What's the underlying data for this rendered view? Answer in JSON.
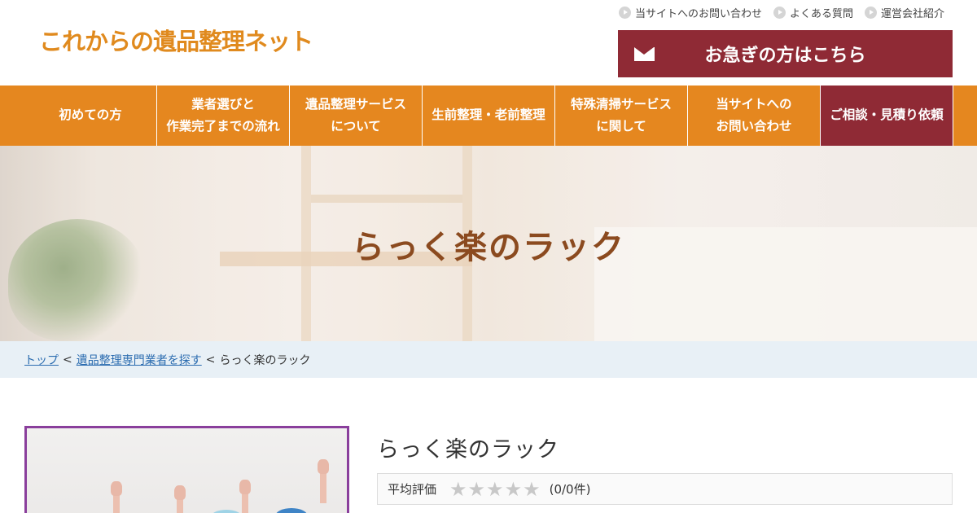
{
  "header": {
    "logo": "これからの遺品整理ネット",
    "top_links": [
      "当サイトへのお問い合わせ",
      "よくある質問",
      "運営会社紹介"
    ],
    "urgent_label": "お急ぎの方はこちら"
  },
  "nav": {
    "items": [
      {
        "label": "初めての方"
      },
      {
        "label": "業者選びと\n作業完了までの流れ"
      },
      {
        "label": "遺品整理サービス\nについて"
      },
      {
        "label": "生前整理・老前整理"
      },
      {
        "label": "特殊清掃サービス\nに関して"
      },
      {
        "label": "当サイトへの\nお問い合わせ"
      },
      {
        "label": "ご相談・見積り依頼"
      }
    ]
  },
  "hero": {
    "title": "らっく楽のラック"
  },
  "breadcrumb": {
    "home": "トップ",
    "category": "遺品整理専門業者を探す",
    "current": "らっく楽のラック",
    "separator": "<"
  },
  "company": {
    "name": "らっく楽のラック",
    "rating_label": "平均評価",
    "stars": "★★★★★",
    "rating_value": 0,
    "rating_count_text": "(0/0件)"
  },
  "colors": {
    "brand_orange": "#e5871f",
    "accent_red": "#8f2a35",
    "hero_title": "#8b4a1f",
    "breadcrumb_bg": "#e8f0f6",
    "photo_border": "#8a3f9c"
  }
}
